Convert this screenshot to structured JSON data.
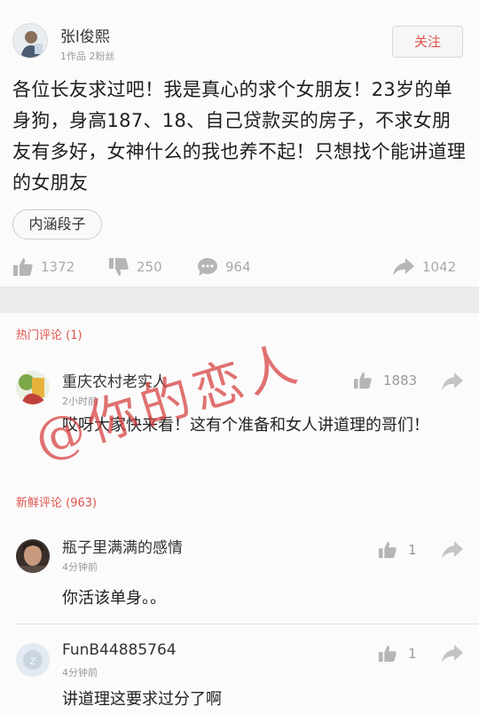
{
  "colors": {
    "accent": "#e0534d",
    "muted": "#999999",
    "watermark": "#d63c3c"
  },
  "post": {
    "author": {
      "name": "张l俊熙",
      "meta": "1作品 2粉丝"
    },
    "follow_label": "关注",
    "text": "各位长友求过吧！我是真心的求个女朋友！23岁的单身狗，身高187、18、自己贷款买的房子，不求女朋友有多好，女神什么的我也养不起！只想找个能讲道理的女朋友",
    "tag": "内涵段子",
    "stats": {
      "likes": "1372",
      "dislikes": "250",
      "comments": "964",
      "shares": "1042"
    }
  },
  "hot": {
    "label": "热门评论 (1)",
    "comments": [
      {
        "name": "重庆农村老实人",
        "time": "2小时前",
        "likes": "1883",
        "text": "哎呀大家快来看！这有个准备和女人讲道理的哥们！"
      }
    ]
  },
  "latest": {
    "label": "新鲜评论 (963)",
    "comments": [
      {
        "name": "瓶子里满满的感情",
        "time": "4分钟前",
        "likes": "1",
        "text": "你活该单身。。"
      },
      {
        "name": "FunB44885764",
        "time": "4分钟前",
        "likes": "1",
        "text": "讲道理这要求过分了啊"
      }
    ]
  },
  "watermark": "@你的恋人",
  "icons": [
    "like-icon",
    "dislike-icon",
    "comment-icon",
    "share-icon"
  ]
}
